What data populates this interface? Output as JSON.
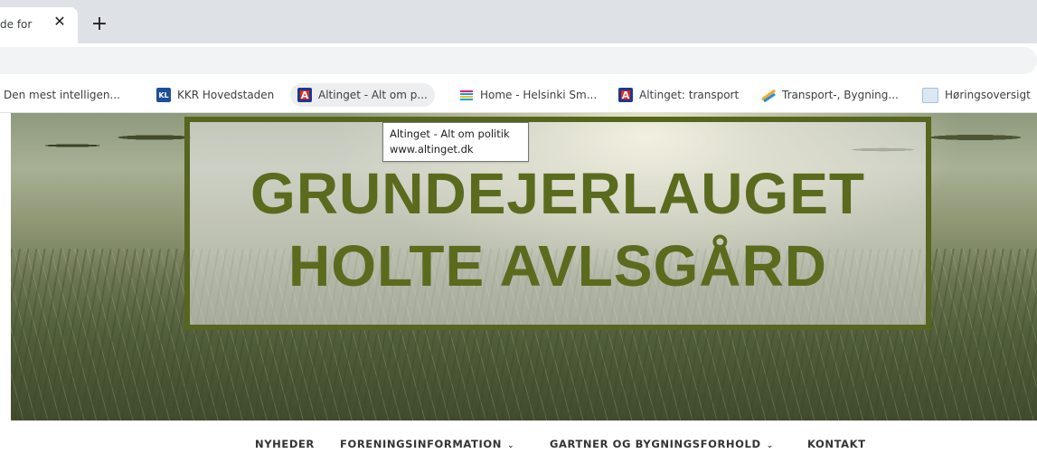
{
  "browser": {
    "active_tab_title": "de for",
    "close_glyph": "✕",
    "new_tab_glyph": "+"
  },
  "bookmarks": [
    {
      "label": "Den mest intelligen...",
      "icon": "none"
    },
    {
      "label": "KKR Hovedstaden",
      "icon": "kl-logo-icon",
      "badge": "KL"
    },
    {
      "label": "Altinget - Alt om p...",
      "icon": "altinget-icon",
      "badge": "A"
    },
    {
      "label": "Home - Helsinki Sm...",
      "icon": "helsinki-icon"
    },
    {
      "label": "Altinget: transport",
      "icon": "altinget-icon",
      "badge": "A"
    },
    {
      "label": "Transport-, Bygning...",
      "icon": "transport-icon"
    },
    {
      "label": "Høringsoversigt",
      "icon": "document-icon"
    }
  ],
  "tooltip": {
    "title": "Altinget - Alt om politik",
    "url": "www.altinget.dk"
  },
  "hero": {
    "title_line1": "GRUNDEJERLAUGET",
    "title_line2": "HOLTE AVLSGÅRD"
  },
  "nav": {
    "items": [
      {
        "label": "NYHEDER",
        "has_dropdown": false
      },
      {
        "label": "FORENINGSINFORMATION",
        "has_dropdown": true
      },
      {
        "label": "GARTNER OG BYGNINGSFORHOLD",
        "has_dropdown": true
      },
      {
        "label": "KONTAKT",
        "has_dropdown": false
      }
    ],
    "chevron_glyph": "⌄"
  },
  "colors": {
    "title_green": "#5a6b1e",
    "frame_green": "#56651f",
    "chrome_gray": "#dee1e6"
  }
}
